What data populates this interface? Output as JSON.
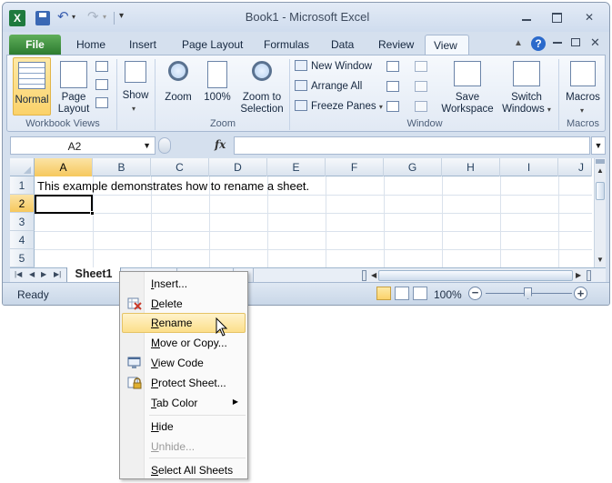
{
  "window": {
    "title": "Book1  -  Microsoft Excel",
    "app_icon_letter": "X"
  },
  "ribbon_tabs": [
    "File",
    "Home",
    "Insert",
    "Page Layout",
    "Formulas",
    "Data",
    "Review",
    "View"
  ],
  "active_tab": "View",
  "ribbon": {
    "workbook_views": {
      "group_label": "Workbook Views",
      "normal_label": "Normal",
      "page_layout_label_1": "Page",
      "page_layout_label_2": "Layout"
    },
    "show": {
      "label": "Show"
    },
    "zoom": {
      "group_label": "Zoom",
      "zoom_label": "Zoom",
      "hundred_label": "100%",
      "selection_label_1": "Zoom to",
      "selection_label_2": "Selection"
    },
    "window": {
      "group_label": "Window",
      "new_window": "New Window",
      "arrange_all": "Arrange All",
      "freeze_panes": "Freeze Panes",
      "save_workspace_1": "Save",
      "save_workspace_2": "Workspace",
      "switch_windows_1": "Switch",
      "switch_windows_2": "Windows"
    },
    "macros": {
      "group_label": "Macros",
      "label": "Macros"
    }
  },
  "formula_bar": {
    "name_box": "A2",
    "fx": "fx",
    "value": ""
  },
  "sheet": {
    "columns": [
      "A",
      "B",
      "C",
      "D",
      "E",
      "F",
      "G",
      "H",
      "I",
      "J"
    ],
    "rows": [
      "1",
      "2",
      "3",
      "4",
      "5"
    ],
    "selected_column": "A",
    "selected_row": "2",
    "cell_a1": "This example demonstrates how to rename a sheet."
  },
  "sheet_tabs": {
    "active": "Sheet1"
  },
  "status": {
    "ready": "Ready",
    "zoom": "100%"
  },
  "context_menu": {
    "items": [
      {
        "label": "Insert...",
        "accel": "I"
      },
      {
        "label": "Delete",
        "accel": "D"
      },
      {
        "label": "Rename",
        "accel": "R"
      },
      {
        "label": "Move or Copy...",
        "accel": "M"
      },
      {
        "label": "View Code",
        "accel": "V"
      },
      {
        "label": "Protect Sheet...",
        "accel": "P"
      },
      {
        "label": "Tab Color",
        "accel": "T"
      },
      {
        "label": "Hide",
        "accel": "H"
      },
      {
        "label": "Unhide...",
        "accel": "U"
      },
      {
        "label": "Select All Sheets",
        "accel": "S"
      }
    ],
    "hovered": "Rename",
    "disabled": [
      "Unhide..."
    ]
  },
  "colors": {
    "file_tab": "#2c7b2f",
    "highlight": "#fbd26a",
    "ribbon_bg": "#e1e9f4"
  }
}
